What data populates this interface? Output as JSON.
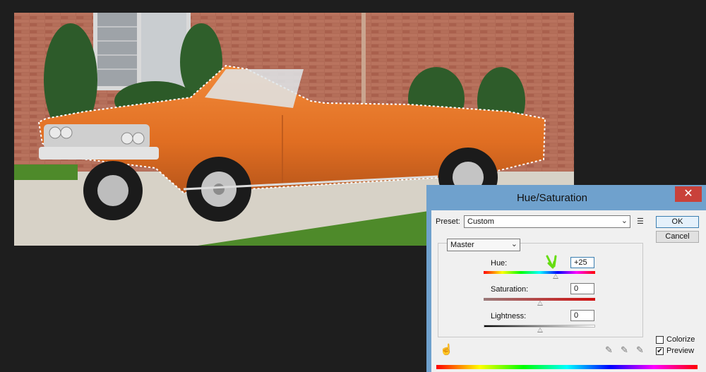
{
  "dialog": {
    "title": "Hue/Saturation",
    "close_glyph": "✕",
    "preset_label": "Preset:",
    "preset_value": "Custom",
    "preset_chevron": "⌄",
    "preset_menu_glyph": "☰",
    "ok_label": "OK",
    "cancel_label": "Cancel",
    "channel_value": "Master",
    "channel_chevron": "⌄",
    "hue_label": "Hue:",
    "hue_value": "+25",
    "saturation_label": "Saturation:",
    "saturation_value": "0",
    "lightness_label": "Lightness:",
    "lightness_value": "0",
    "colorize_label": "Colorize",
    "colorize_checked": false,
    "preview_label": "Preview",
    "preview_checked": true,
    "preview_check_glyph": "✔",
    "hand_tool_glyph": "☝",
    "eyedropper_glyph": "✎",
    "annotation_arrow_color": "#66dd11"
  },
  "canvas": {
    "car_color": "#e87a2c",
    "brick_color": "#b26a57",
    "grass_color": "#4e8a2a"
  }
}
